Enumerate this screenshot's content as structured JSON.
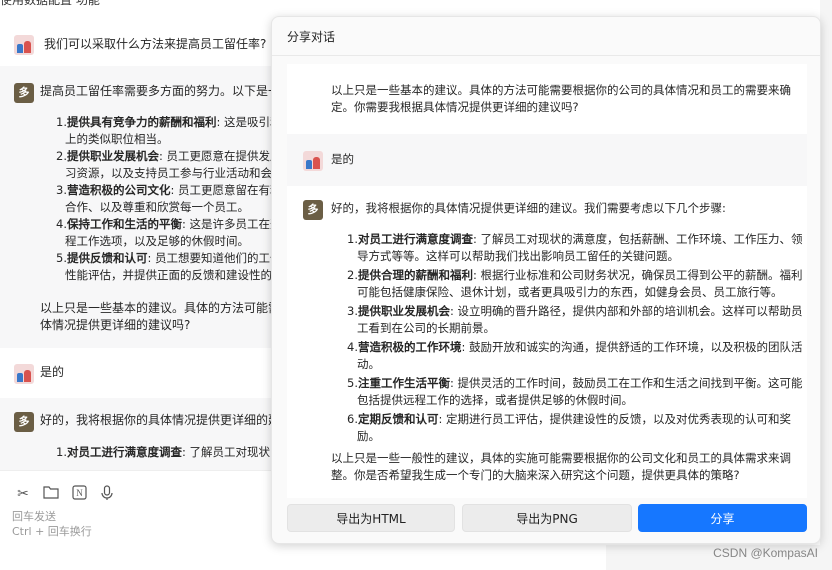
{
  "background_chat": {
    "top_cut_text": "使用数据配置 功能",
    "user_question": "我们可以采取什么方法来提高员工留任率?",
    "bot_intro": "提高员工留任率需要多方面的努力。以下是一些",
    "bot_list": [
      {
        "n": "1.",
        "bold": "提供具有竞争力的薪酬和福利",
        "line1": ": 这是吸引和",
        "line2": "上的类似职位相当。"
      },
      {
        "n": "2.",
        "bold": "提供职业发展机会",
        "line1": ": 员工更愿意在提供发展",
        "line2": "习资源，以及支持员工参与行业活动和会议"
      },
      {
        "n": "3.",
        "bold": "营造积极的公司文化",
        "line1": ": 员工更愿意留在有利",
        "line2": "合作、以及尊重和欣赏每一个员工。"
      },
      {
        "n": "4.",
        "bold": "保持工作和生活的平衡",
        "line1": ": 这是许多员工在选",
        "line2": "程工作选项，以及足够的休假时间。"
      },
      {
        "n": "5.",
        "bold": "提供反馈和认可",
        "line1": ": 员工想要知道他们的工作",
        "line2": "性能评估，并提供正面的反馈和建设性的批"
      }
    ],
    "bot_outro_1": "以上只是一些基本的建议。具体的方法可能需要",
    "bot_outro_2": "体情况提供更详细的建议吗?",
    "user_reply": "是的",
    "bot_reply_intro": "好的，我将根据你的具体情况提供更详细的建议",
    "bot_reply_item": {
      "n": "1.",
      "bold": "对员工进行满意度调查",
      "rest": ": 了解员工对现状的"
    },
    "input_hint_1": "回车发送",
    "input_hint_2": "Ctrl + 回车换行",
    "tools": [
      "scissors-icon",
      "folder-icon",
      "notion-icon",
      "microphone-icon"
    ]
  },
  "modal": {
    "title": "分享对话",
    "preview": {
      "top_text_1": "以上只是一些基本的建议。具体的方法可能需要根据你的公司的具体情况和员工的需要来确",
      "top_text_2": "定。你需要我根据具体情况提供更详细的建议吗?",
      "user_reply": "是的",
      "bot_intro": "好的，我将根据你的具体情况提供更详细的建议。我们需要考虑以下几个步骤:",
      "steps": [
        {
          "n": "1.",
          "bold": "对员工进行满意度调查",
          "line1": ": 了解员工对现状的满意度，包括薪酬、工作环境、工作压力、领",
          "line2": "导方式等等。这样可以帮助我们找出影响员工留任的关键问题。"
        },
        {
          "n": "2.",
          "bold": "提供合理的薪酬和福利",
          "line1": ": 根据行业标准和公司财务状况，确保员工得到公平的薪酬。福利",
          "line2": "可能包括健康保险、退休计划，或者更具吸引力的东西，如健身会员、员工旅行等。"
        },
        {
          "n": "3.",
          "bold": "提供职业发展机会",
          "line1": ": 设立明确的晋升路径，提供内部和外部的培训机会。这样可以帮助员",
          "line2": "工看到在公司的长期前景。"
        },
        {
          "n": "4.",
          "bold": "营造积极的工作环境",
          "line1": ": 鼓励开放和诚实的沟通，提供舒适的工作环境，以及积极的团队活",
          "line2": "动。"
        },
        {
          "n": "5.",
          "bold": "注重工作生活平衡",
          "line1": ": 提供灵活的工作时间，鼓励员工在工作和生活之间找到平衡。这可能",
          "line2": "包括提供远程工作的选择，或者提供足够的休假时间。"
        },
        {
          "n": "6.",
          "bold": "定期反馈和认可",
          "line1": ": 定期进行员工评估，提供建设性的反馈，以及对优秀表现的认可和奖",
          "line2": "励。"
        }
      ],
      "outro_1": "以上只是一些一般性的建议，具体的实施可能需要根据你的公司文化和员工的具体需求来调",
      "outro_2": "整。你是否希望我生成一个专门的大脑来深入研究这个问题，提供更具体的策略?"
    },
    "buttons": {
      "export_html": "导出为HTML",
      "export_png": "导出为PNG",
      "share": "分享"
    }
  },
  "watermark": "CSDN @KompasAI",
  "colors": {
    "primary": "#1677ff",
    "bot_avatar": "#6b5e45"
  }
}
